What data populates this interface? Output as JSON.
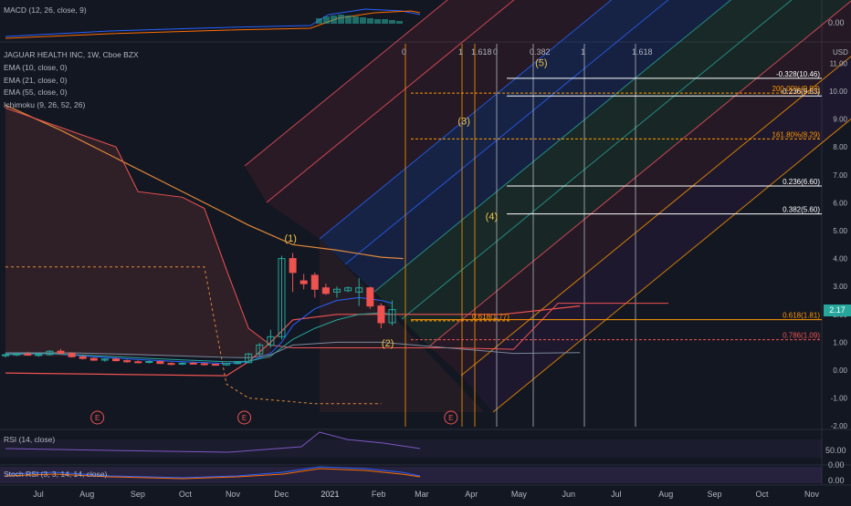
{
  "colors": {
    "background": "#131722",
    "up": "#26a69a",
    "down": "#ef5350",
    "ema10": "#2962ff",
    "ema21": "#26a69a",
    "ema55": "#f7525f",
    "fib_line": "#ffffff",
    "fib_orange": "#ff9800",
    "macd_line": "#2962ff",
    "signal_line": "#ff6d00",
    "rsi_line": "#7e57c2",
    "price_badge": "#26a69a"
  },
  "header": {
    "macd_title": "MACD (12, 26, close, 9)",
    "symbol": "JAGUAR HEALTH INC, 1W, Cboe BZX",
    "ema10": "EMA (10, close, 0)",
    "ema21": "EMA (21, close, 0)",
    "ema55": "EMA (55, close, 0)",
    "ichimoku": "Ichimoku (9, 26, 52, 26)",
    "rsi_title": "RSI (14, close)",
    "stoch_title": "Stoch RSI (3, 3, 14, 14, close)"
  },
  "price_axis": {
    "currency": "USD",
    "current_price": "2.17"
  },
  "macd_axis": {
    "ticks": [
      "0.00"
    ]
  },
  "rsi_axis": {
    "ticks": [
      "50.00",
      "0.00"
    ]
  },
  "stoch_axis": {
    "ticks": [
      "0.00"
    ]
  },
  "chart_data": {
    "type": "candlestick",
    "x_unit": "week",
    "ylim": [
      -2,
      11
    ],
    "y_ticks": [
      -2,
      -1,
      0,
      1,
      2,
      3,
      4,
      5,
      6,
      7,
      8,
      9,
      10,
      11
    ],
    "x_ticks": [
      {
        "label": "Jul",
        "week": 0
      },
      {
        "label": "Aug",
        "week": 4.4
      },
      {
        "label": "Sep",
        "week": 9
      },
      {
        "label": "Oct",
        "week": 13.3
      },
      {
        "label": "Nov",
        "week": 17.6
      },
      {
        "label": "Dec",
        "week": 22
      },
      {
        "label": "2021",
        "week": 26.4
      },
      {
        "label": "Feb",
        "week": 30.8
      },
      {
        "label": "Mar",
        "week": 34.7
      },
      {
        "label": "Apr",
        "week": 39.2
      },
      {
        "label": "May",
        "week": 43.5
      },
      {
        "label": "Jun",
        "week": 48
      },
      {
        "label": "Jul",
        "week": 52.3
      },
      {
        "label": "Aug",
        "week": 56.8
      },
      {
        "label": "Sep",
        "week": 61.2
      },
      {
        "label": "Oct",
        "week": 65.5
      },
      {
        "label": "Nov",
        "week": 70
      }
    ],
    "candles": [
      {
        "o": 0.52,
        "h": 0.6,
        "l": 0.45,
        "c": 0.55
      },
      {
        "o": 0.55,
        "h": 0.62,
        "l": 0.5,
        "c": 0.58
      },
      {
        "o": 0.58,
        "h": 0.66,
        "l": 0.52,
        "c": 0.54
      },
      {
        "o": 0.54,
        "h": 0.6,
        "l": 0.48,
        "c": 0.56
      },
      {
        "o": 0.56,
        "h": 0.72,
        "l": 0.52,
        "c": 0.68
      },
      {
        "o": 0.68,
        "h": 0.76,
        "l": 0.55,
        "c": 0.6
      },
      {
        "o": 0.6,
        "h": 0.64,
        "l": 0.45,
        "c": 0.48
      },
      {
        "o": 0.48,
        "h": 0.52,
        "l": 0.38,
        "c": 0.42
      },
      {
        "o": 0.42,
        "h": 0.46,
        "l": 0.33,
        "c": 0.36
      },
      {
        "o": 0.36,
        "h": 0.42,
        "l": 0.3,
        "c": 0.4
      },
      {
        "o": 0.4,
        "h": 0.44,
        "l": 0.32,
        "c": 0.34
      },
      {
        "o": 0.34,
        "h": 0.38,
        "l": 0.27,
        "c": 0.3
      },
      {
        "o": 0.3,
        "h": 0.35,
        "l": 0.25,
        "c": 0.28
      },
      {
        "o": 0.28,
        "h": 0.34,
        "l": 0.24,
        "c": 0.31
      },
      {
        "o": 0.31,
        "h": 0.34,
        "l": 0.22,
        "c": 0.24
      },
      {
        "o": 0.24,
        "h": 0.28,
        "l": 0.18,
        "c": 0.22
      },
      {
        "o": 0.22,
        "h": 0.28,
        "l": 0.18,
        "c": 0.25
      },
      {
        "o": 0.25,
        "h": 0.3,
        "l": 0.2,
        "c": 0.23
      },
      {
        "o": 0.23,
        "h": 0.27,
        "l": 0.17,
        "c": 0.21
      },
      {
        "o": 0.21,
        "h": 0.24,
        "l": 0.16,
        "c": 0.19
      },
      {
        "o": 0.19,
        "h": 0.26,
        "l": 0.16,
        "c": 0.24
      },
      {
        "o": 0.24,
        "h": 0.3,
        "l": 0.2,
        "c": 0.27
      },
      {
        "o": 0.27,
        "h": 0.62,
        "l": 0.25,
        "c": 0.58
      },
      {
        "o": 0.58,
        "h": 0.98,
        "l": 0.5,
        "c": 0.9
      },
      {
        "o": 0.9,
        "h": 1.45,
        "l": 0.8,
        "c": 1.2
      },
      {
        "o": 1.2,
        "h": 4.1,
        "l": 1.1,
        "c": 4.0
      },
      {
        "o": 4.0,
        "h": 4.2,
        "l": 2.8,
        "c": 3.5
      },
      {
        "o": 3.2,
        "h": 3.45,
        "l": 2.9,
        "c": 3.1
      },
      {
        "o": 3.4,
        "h": 3.5,
        "l": 2.6,
        "c": 2.9
      },
      {
        "o": 2.95,
        "h": 3.1,
        "l": 2.7,
        "c": 2.75
      },
      {
        "o": 2.8,
        "h": 3.0,
        "l": 2.6,
        "c": 2.9
      },
      {
        "o": 2.85,
        "h": 3.0,
        "l": 2.8,
        "c": 2.95
      },
      {
        "o": 2.8,
        "h": 3.3,
        "l": 2.3,
        "c": 2.95
      },
      {
        "o": 2.95,
        "h": 3.0,
        "l": 2.2,
        "c": 2.3
      },
      {
        "o": 2.3,
        "h": 2.4,
        "l": 1.5,
        "c": 1.7
      },
      {
        "o": 1.7,
        "h": 2.5,
        "l": 1.6,
        "c": 2.17
      }
    ],
    "ema10": [
      [
        0,
        0.56
      ],
      [
        4,
        0.6
      ],
      [
        8,
        0.48
      ],
      [
        12,
        0.38
      ],
      [
        16,
        0.3
      ],
      [
        20,
        0.24
      ],
      [
        22,
        0.3
      ],
      [
        24,
        0.6
      ],
      [
        25,
        1.0
      ],
      [
        26,
        1.6
      ],
      [
        28,
        2.2
      ],
      [
        30,
        2.5
      ],
      [
        32,
        2.6
      ],
      [
        34,
        2.5
      ],
      [
        35,
        2.4
      ]
    ],
    "ema21": [
      [
        0,
        0.58
      ],
      [
        4,
        0.6
      ],
      [
        8,
        0.52
      ],
      [
        12,
        0.44
      ],
      [
        16,
        0.37
      ],
      [
        20,
        0.3
      ],
      [
        22,
        0.32
      ],
      [
        24,
        0.5
      ],
      [
        26,
        1.1
      ],
      [
        28,
        1.5
      ],
      [
        30,
        1.8
      ],
      [
        32,
        2.0
      ],
      [
        34,
        2.05
      ],
      [
        35,
        2.0
      ]
    ],
    "ema55": [
      [
        0,
        0.62
      ],
      [
        6,
        0.62
      ],
      [
        12,
        0.56
      ],
      [
        18,
        0.48
      ],
      [
        22,
        0.44
      ],
      [
        24,
        0.55
      ],
      [
        26,
        0.9
      ],
      [
        30,
        1.0
      ],
      [
        34,
        1.0
      ],
      [
        40,
        0.8
      ],
      [
        46,
        0.6
      ],
      [
        52,
        0.63
      ]
    ],
    "ichimoku_lagging": [
      [
        0,
        0.52
      ],
      [
        4,
        0.6
      ],
      [
        8,
        0.42
      ],
      [
        12,
        0.3
      ],
      [
        16,
        0.22
      ],
      [
        20,
        0.2
      ],
      [
        22,
        0.28
      ],
      [
        24,
        0.9
      ],
      [
        25,
        4.0
      ],
      [
        26,
        3.1
      ],
      [
        27,
        2.9
      ],
      [
        28,
        2.7
      ],
      [
        30,
        2.9
      ],
      [
        31,
        2.4
      ],
      [
        32,
        1.7
      ],
      [
        33,
        2.2
      ]
    ],
    "ichimoku_span_a": [
      [
        0,
        9.4
      ],
      [
        10,
        8.0
      ],
      [
        12,
        6.4
      ],
      [
        16,
        6.2
      ],
      [
        18,
        5.8
      ],
      [
        20,
        3.6
      ],
      [
        22,
        1.5
      ],
      [
        24,
        0.9
      ],
      [
        26,
        0.8
      ],
      [
        30,
        0.8
      ],
      [
        34,
        0.8
      ],
      [
        40,
        0.8
      ],
      [
        46,
        0.75
      ],
      [
        50,
        2.4
      ],
      [
        56,
        2.4
      ],
      [
        60,
        2.4
      ]
    ],
    "ichimoku_span_b": [
      [
        0,
        3.7
      ],
      [
        14,
        3.7
      ],
      [
        18,
        3.7
      ],
      [
        20,
        -0.5
      ],
      [
        22,
        -1.0
      ],
      [
        28,
        -1.2
      ],
      [
        34,
        -1.2
      ]
    ],
    "ichimoku_base": [
      [
        0,
        -0.1
      ],
      [
        20,
        -0.2
      ],
      [
        22,
        0.3
      ],
      [
        24,
        1.0
      ],
      [
        26,
        1.8
      ],
      [
        30,
        2.0
      ],
      [
        34,
        2.0
      ],
      [
        45,
        2.0
      ],
      [
        52,
        2.3
      ]
    ],
    "ichimoku_orange_curve": [
      [
        0,
        9.5
      ],
      [
        5,
        8.6
      ],
      [
        10,
        7.6
      ],
      [
        14,
        6.8
      ],
      [
        18,
        6.0
      ],
      [
        20,
        5.6
      ],
      [
        22,
        5.2
      ],
      [
        26,
        4.5
      ],
      [
        30,
        4.3
      ],
      [
        34,
        4.05
      ],
      [
        36,
        4.0
      ]
    ],
    "fib_levels": [
      {
        "label": "-0.328(10.46)",
        "value": 10.46,
        "color": "#ffffff",
        "dashed": false
      },
      {
        "label": "-0.236(9.83)",
        "value": 9.83,
        "color": "#ffffff",
        "dashed": false
      },
      {
        "label": "200.00%(9.93)",
        "value": 9.93,
        "color": "#ff9800",
        "dashed": true
      },
      {
        "label": "161.80%(8.29)",
        "value": 8.29,
        "color": "#ff9800",
        "dashed": true
      },
      {
        "label": "0.236(6.60)",
        "value": 6.6,
        "color": "#ffffff",
        "dashed": false
      },
      {
        "label": "0.382(5.60)",
        "value": 5.6,
        "color": "#ffffff",
        "dashed": false
      },
      {
        "label": "0.618(1.81)",
        "value": 1.81,
        "color": "#ff9800",
        "dashed": false
      },
      {
        "label": "0.618(1.77)",
        "value": 1.77,
        "color": "#ff9800",
        "dashed": true
      },
      {
        "label": "0.786(1.09)",
        "value": 1.09,
        "color": "#ef5350",
        "dashed": true
      }
    ],
    "fib_time_top_labels": [
      "0",
      "1",
      "1.618",
      "0",
      "0.382",
      "1",
      "1.618"
    ],
    "elliott_waves": [
      {
        "label": "(1)",
        "week": 25.8,
        "value": 4.6
      },
      {
        "label": "(2)",
        "week": 34.6,
        "value": 0.85
      },
      {
        "label": "(3)",
        "week": 41.5,
        "value": 8.8
      },
      {
        "label": "(4)",
        "week": 44.0,
        "value": 5.4
      },
      {
        "label": "(5)",
        "week": 48.5,
        "value": 10.9
      }
    ],
    "earnings_markers": [
      {
        "label": "E",
        "week": 6.5
      },
      {
        "label": "E",
        "week": 19.8
      },
      {
        "label": "E",
        "week": 38.5
      }
    ]
  }
}
